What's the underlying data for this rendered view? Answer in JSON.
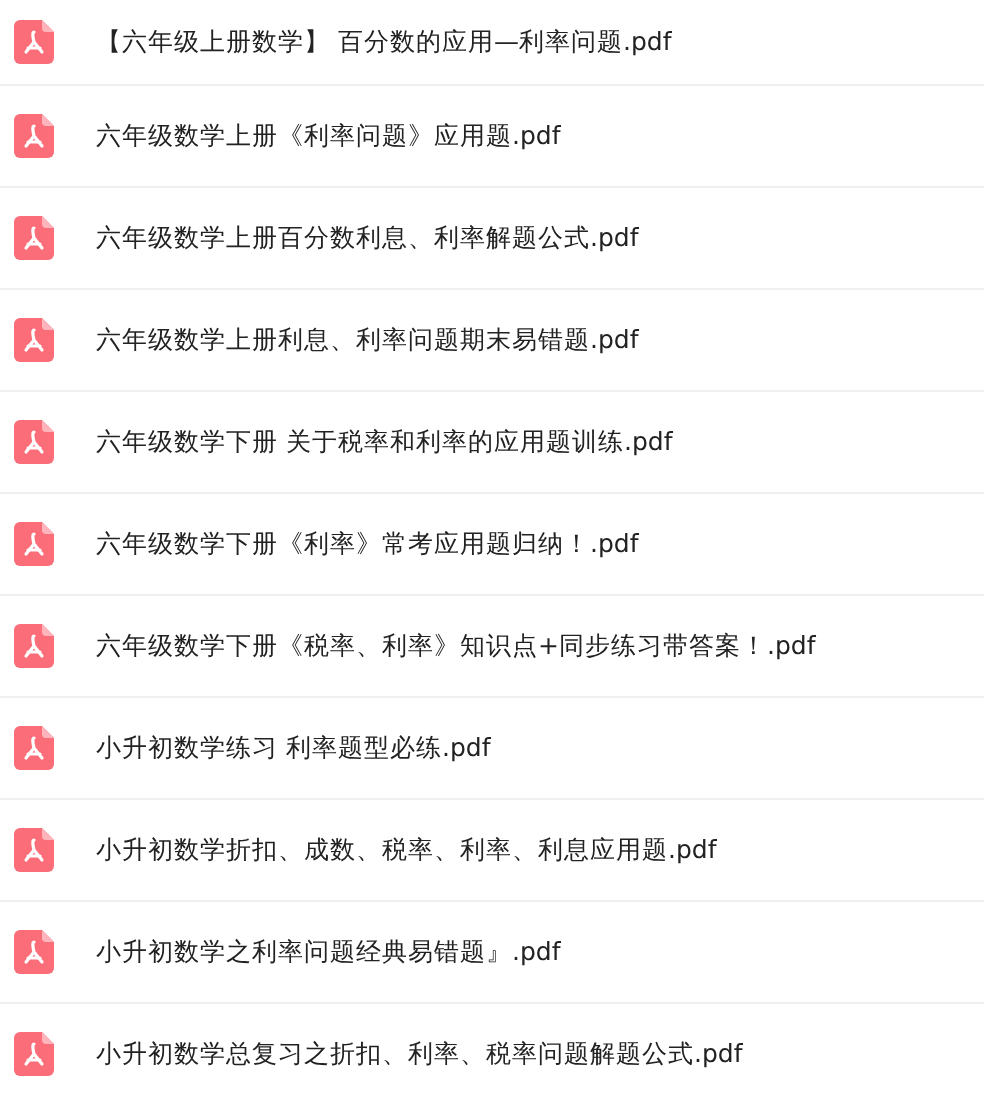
{
  "files": [
    {
      "name": "【六年级上册数学】 百分数的应用—利率问题.pdf"
    },
    {
      "name": "六年级数学上册《利率问题》应用题.pdf"
    },
    {
      "name": "六年级数学上册百分数利息、利率解题公式.pdf"
    },
    {
      "name": "六年级数学上册利息、利率问题期末易错题.pdf"
    },
    {
      "name": "六年级数学下册 关于税率和利率的应用题训练.pdf"
    },
    {
      "name": "六年级数学下册《利率》常考应用题归纳！.pdf"
    },
    {
      "name": "六年级数学下册《税率、利率》知识点+同步练习带答案！.pdf"
    },
    {
      "name": "小升初数学练习 利率题型必练.pdf"
    },
    {
      "name": "小升初数学折扣、成数、税率、利率、利息应用题.pdf"
    },
    {
      "name": "小升初数学之利率问题经典易错题』.pdf"
    },
    {
      "name": "小升初数学总复习之折扣、利率、税率问题解题公式.pdf"
    }
  ]
}
